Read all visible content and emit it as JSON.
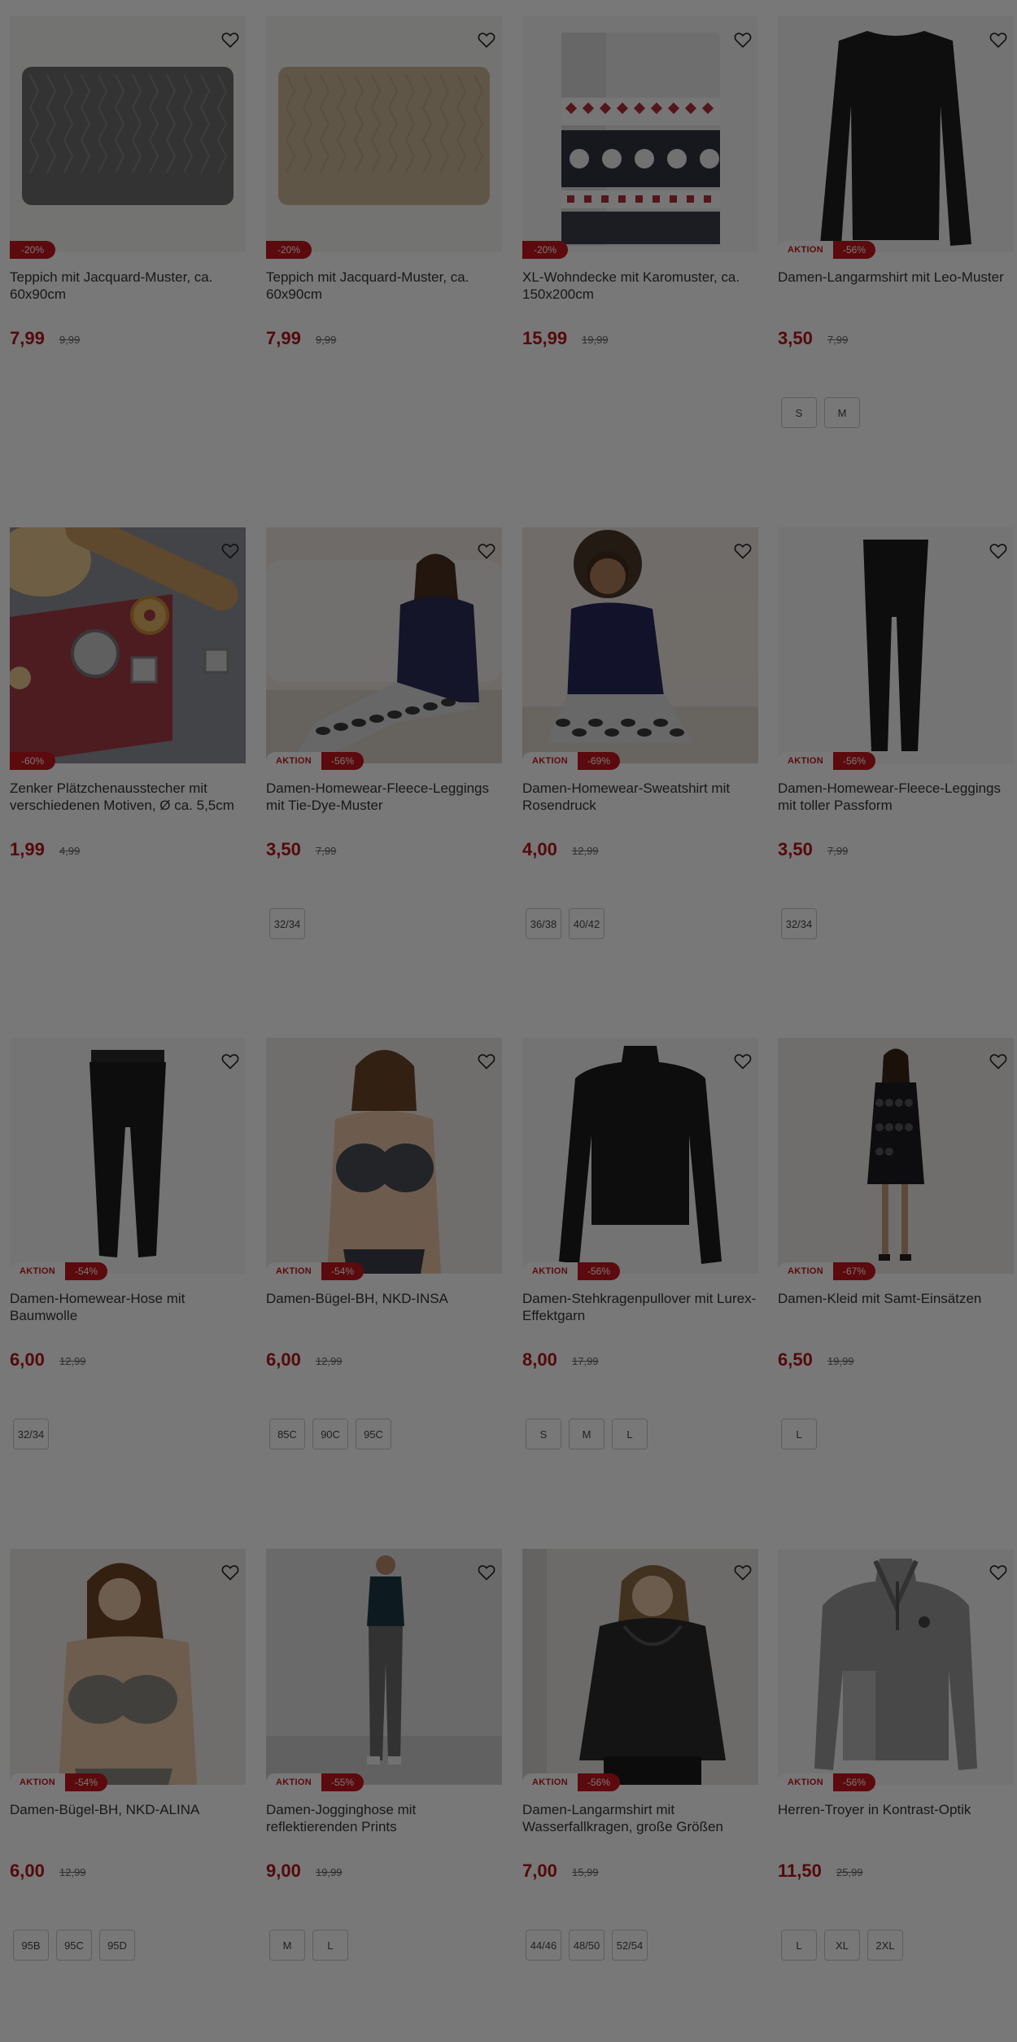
{
  "products": [
    {
      "title": "Teppich mit Jacquard-Muster, ca. 60x90cm",
      "price": "7,99",
      "old_price": "9,99",
      "aktion": "",
      "discount": "-20%",
      "sizes": [],
      "image": "rug-dark-grey"
    },
    {
      "title": "Teppich mit Jacquard-Muster, ca. 60x90cm",
      "price": "7,99",
      "old_price": "9,99",
      "aktion": "",
      "discount": "-20%",
      "sizes": [],
      "image": "rug-beige"
    },
    {
      "title": "XL-Wohndecke mit Karomuster, ca. 150x200cm",
      "price": "15,99",
      "old_price": "19,99",
      "aktion": "",
      "discount": "-20%",
      "sizes": [],
      "image": "blanket-nordic"
    },
    {
      "title": "Damen-Langarmshirt mit Leo-Muster",
      "price": "3,50",
      "old_price": "7,99",
      "aktion": "AKTION",
      "discount": "-56%",
      "sizes": [
        "S",
        "M"
      ],
      "image": "black-longsleeve"
    },
    {
      "title": "Zenker Plätzchenausstecher mit verschiedenen Motiven, Ø ca. 5,5cm",
      "price": "1,99",
      "old_price": "4,99",
      "aktion": "",
      "discount": "-60%",
      "sizes": [],
      "image": "cookie-cutters"
    },
    {
      "title": "Damen-Homewear-Fleece-Leggings mit Tie-Dye-Muster",
      "price": "3,50",
      "old_price": "7,99",
      "aktion": "AKTION",
      "discount": "-56%",
      "sizes": [
        "32/34"
      ],
      "image": "woman-homewear"
    },
    {
      "title": "Damen-Homewear-Sweatshirt mit Rosendruck",
      "price": "4,00",
      "old_price": "12,99",
      "aktion": "AKTION",
      "discount": "-69%",
      "sizes": [
        "36/38",
        "40/42"
      ],
      "image": "woman-homewear-2"
    },
    {
      "title": "Damen-Homewear-Fleece-Leggings mit toller Passform",
      "price": "3,50",
      "old_price": "7,99",
      "aktion": "AKTION",
      "discount": "-56%",
      "sizes": [
        "32/34"
      ],
      "image": "black-leggings"
    },
    {
      "title": "Damen-Homewear-Hose mit Baumwolle",
      "price": "6,00",
      "old_price": "12,99",
      "aktion": "AKTION",
      "discount": "-54%",
      "sizes": [
        "32/34"
      ],
      "image": "black-joggers"
    },
    {
      "title": "Damen-Bügel-BH, NKD-INSA",
      "price": "6,00",
      "old_price": "12,99",
      "aktion": "AKTION",
      "discount": "-54%",
      "sizes": [
        "85C",
        "90C",
        "95C"
      ],
      "image": "bra-model"
    },
    {
      "title": "Damen-Stehkragenpullover mit Lurex-Effektgarn",
      "price": "8,00",
      "old_price": "17,99",
      "aktion": "AKTION",
      "discount": "-56%",
      "sizes": [
        "S",
        "M",
        "L"
      ],
      "image": "black-turtleneck"
    },
    {
      "title": "Damen-Kleid mit Samt-Einsätzen",
      "price": "6,50",
      "old_price": "19,99",
      "aktion": "AKTION",
      "discount": "-67%",
      "sizes": [
        "L"
      ],
      "image": "dress-model"
    },
    {
      "title": "Damen-Bügel-BH, NKD-ALINA",
      "price": "6,00",
      "old_price": "12,99",
      "aktion": "AKTION",
      "discount": "-54%",
      "sizes": [
        "95B",
        "95C",
        "95D"
      ],
      "image": "bra-model-2"
    },
    {
      "title": "Damen-Jogginghose mit reflektierenden Prints",
      "price": "9,00",
      "old_price": "19,99",
      "aktion": "AKTION",
      "discount": "-55%",
      "sizes": [
        "M",
        "L"
      ],
      "image": "jogger-model"
    },
    {
      "title": "Damen-Langarmshirt mit Wasserfallkragen, große Größen",
      "price": "7,00",
      "old_price": "15,99",
      "aktion": "AKTION",
      "discount": "-56%",
      "sizes": [
        "44/46",
        "48/50",
        "52/54"
      ],
      "image": "plus-size-model"
    },
    {
      "title": "Herren-Troyer in Kontrast-Optik",
      "price": "11,50",
      "old_price": "25,99",
      "aktion": "AKTION",
      "discount": "-56%",
      "sizes": [
        "L",
        "XL",
        "2XL"
      ],
      "image": "grey-troyer"
    }
  ],
  "colors": {
    "accent": "#c4161c",
    "price": "#b3151a",
    "overlay": "rgba(0,0,0,0.53)"
  }
}
